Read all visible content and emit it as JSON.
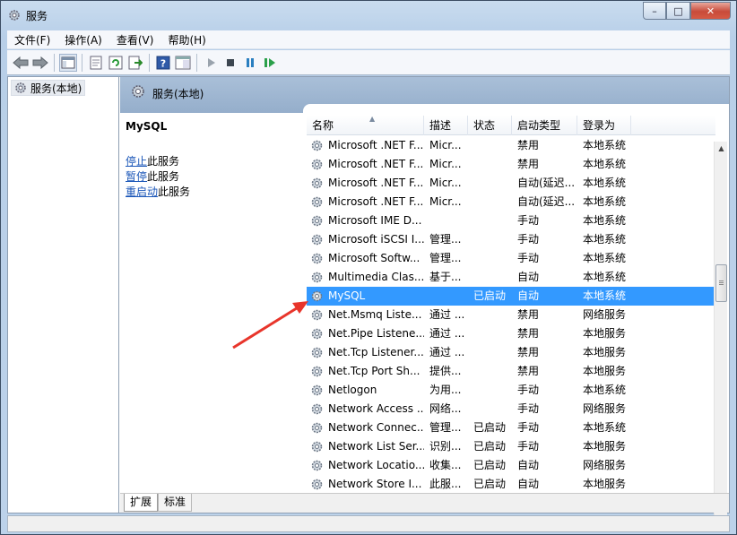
{
  "window": {
    "title": "服务",
    "minimize": "–",
    "maximize": "□",
    "close": "✕"
  },
  "menu": [
    "文件(F)",
    "操作(A)",
    "查看(V)",
    "帮助(H)"
  ],
  "toolbar": {
    "icons": [
      "back-icon",
      "forward-icon",
      "console-tree-icon",
      "properties-icon",
      "refresh-icon",
      "export-list-icon",
      "help-icon",
      "view-icon",
      "start-service-icon",
      "stop-service-icon",
      "pause-service-icon",
      "restart-service-icon"
    ]
  },
  "tree": {
    "root_label": "服务(本地)"
  },
  "pane_header": {
    "title": "服务(本地)"
  },
  "detail": {
    "service_name": "MySQL",
    "actions": [
      {
        "link": "停止",
        "suffix": "此服务"
      },
      {
        "link": "暂停",
        "suffix": "此服务"
      },
      {
        "link": "重启动",
        "suffix": "此服务"
      }
    ]
  },
  "columns": [
    "名称",
    "描述",
    "状态",
    "启动类型",
    "登录为"
  ],
  "services": [
    {
      "name": "Microsoft .NET F...",
      "desc": "Micr...",
      "status": "",
      "startup": "禁用",
      "logon": "本地系统"
    },
    {
      "name": "Microsoft .NET F...",
      "desc": "Micr...",
      "status": "",
      "startup": "禁用",
      "logon": "本地系统"
    },
    {
      "name": "Microsoft .NET F...",
      "desc": "Micr...",
      "status": "",
      "startup": "自动(延迟...",
      "logon": "本地系统"
    },
    {
      "name": "Microsoft .NET F...",
      "desc": "Micr...",
      "status": "",
      "startup": "自动(延迟...",
      "logon": "本地系统"
    },
    {
      "name": "Microsoft IME D...",
      "desc": "",
      "status": "",
      "startup": "手动",
      "logon": "本地系统"
    },
    {
      "name": "Microsoft iSCSI I...",
      "desc": "管理...",
      "status": "",
      "startup": "手动",
      "logon": "本地系统"
    },
    {
      "name": "Microsoft Softw...",
      "desc": "管理...",
      "status": "",
      "startup": "手动",
      "logon": "本地系统"
    },
    {
      "name": "Multimedia Clas...",
      "desc": "基于...",
      "status": "",
      "startup": "自动",
      "logon": "本地系统"
    },
    {
      "name": "MySQL",
      "desc": "",
      "status": "已启动",
      "startup": "自动",
      "logon": "本地系统",
      "selected": true
    },
    {
      "name": "Net.Msmq Liste...",
      "desc": "通过 ...",
      "status": "",
      "startup": "禁用",
      "logon": "网络服务"
    },
    {
      "name": "Net.Pipe Listene...",
      "desc": "通过 ...",
      "status": "",
      "startup": "禁用",
      "logon": "本地服务"
    },
    {
      "name": "Net.Tcp Listener...",
      "desc": "通过 ...",
      "status": "",
      "startup": "禁用",
      "logon": "本地服务"
    },
    {
      "name": "Net.Tcp Port Sh...",
      "desc": "提供...",
      "status": "",
      "startup": "禁用",
      "logon": "本地服务"
    },
    {
      "name": "Netlogon",
      "desc": "为用...",
      "status": "",
      "startup": "手动",
      "logon": "本地系统"
    },
    {
      "name": "Network Access ...",
      "desc": "网络...",
      "status": "",
      "startup": "手动",
      "logon": "网络服务"
    },
    {
      "name": "Network Connec...",
      "desc": "管理...",
      "status": "已启动",
      "startup": "手动",
      "logon": "本地系统"
    },
    {
      "name": "Network List Ser...",
      "desc": "识别...",
      "status": "已启动",
      "startup": "手动",
      "logon": "本地服务"
    },
    {
      "name": "Network Locatio...",
      "desc": "收集...",
      "status": "已启动",
      "startup": "自动",
      "logon": "网络服务"
    },
    {
      "name": "Network Store I...",
      "desc": "此服...",
      "status": "已启动",
      "startup": "自动",
      "logon": "本地服务"
    }
  ],
  "tabs": [
    "扩展",
    "标准"
  ],
  "colors": {
    "selection": "#3399ff",
    "link": "#1a56b8",
    "annotation_arrow": "#e8352b"
  }
}
